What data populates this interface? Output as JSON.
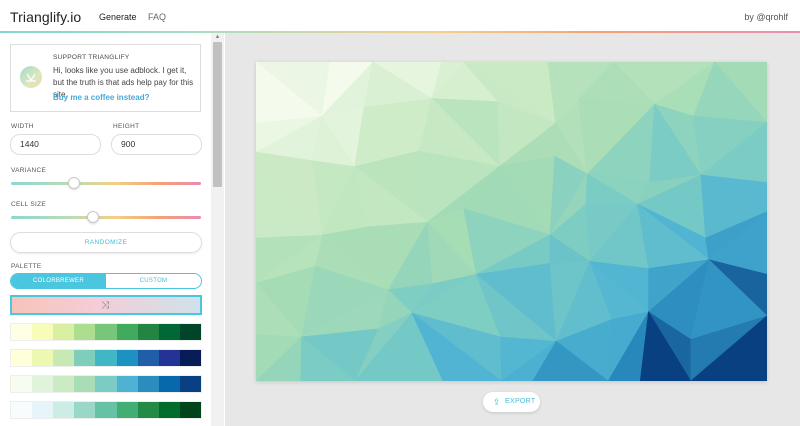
{
  "header": {
    "logo": "Trianglify.io",
    "nav": {
      "generate": "Generate",
      "faq": "FAQ"
    },
    "byline": "by @qrohlf"
  },
  "sidebar": {
    "support": {
      "title": "SUPPORT TRIANGLIFY",
      "text": "Hi, looks like you use adblock. I get it, but the truth is that ads help pay for this site.",
      "link": "Buy me a coffee instead?"
    },
    "width": {
      "label": "WIDTH",
      "value": "1440"
    },
    "height": {
      "label": "HEIGHT",
      "value": "900"
    },
    "variance": {
      "label": "VARIANCE",
      "level": 0.33
    },
    "cell_size": {
      "label": "CELL SIZE",
      "level": 0.43
    },
    "randomize_label": "RANDOMIZE",
    "palette": {
      "label": "PALETTE",
      "tabs": {
        "colorbrewer": "COLORBREWER",
        "custom": "CUSTOM"
      },
      "active_tab": "colorbrewer",
      "shuffle_icon": "shuffle-icon",
      "rows": [
        [
          "#ffffe5",
          "#f7fcb9",
          "#d9f0a3",
          "#addd8e",
          "#78c679",
          "#41ab5d",
          "#238443",
          "#006837",
          "#004529"
        ],
        [
          "#ffffd9",
          "#edf8b1",
          "#c7e9b4",
          "#7fcdbb",
          "#41b6c4",
          "#1d91c0",
          "#225ea8",
          "#253494",
          "#081d58"
        ],
        [
          "#f7fcf0",
          "#e0f3db",
          "#ccebc5",
          "#a8ddb5",
          "#7bccc4",
          "#4eb3d3",
          "#2b8cbe",
          "#0868ac",
          "#084081"
        ],
        [
          "#f7fcfd",
          "#e5f5f9",
          "#ccece6",
          "#99d8c9",
          "#66c2a4",
          "#41ae76",
          "#238b45",
          "#006d2c",
          "#00441b"
        ],
        [
          "#f7fcfd",
          "#e0ecf4",
          "#bfd3e6",
          "#9ebcda",
          "#8c96c6",
          "#8c6bb1",
          "#88419d",
          "#810f7c",
          "#4d004b"
        ]
      ]
    }
  },
  "main": {
    "export_label": "EXPORT",
    "export_icon": "export-icon"
  }
}
